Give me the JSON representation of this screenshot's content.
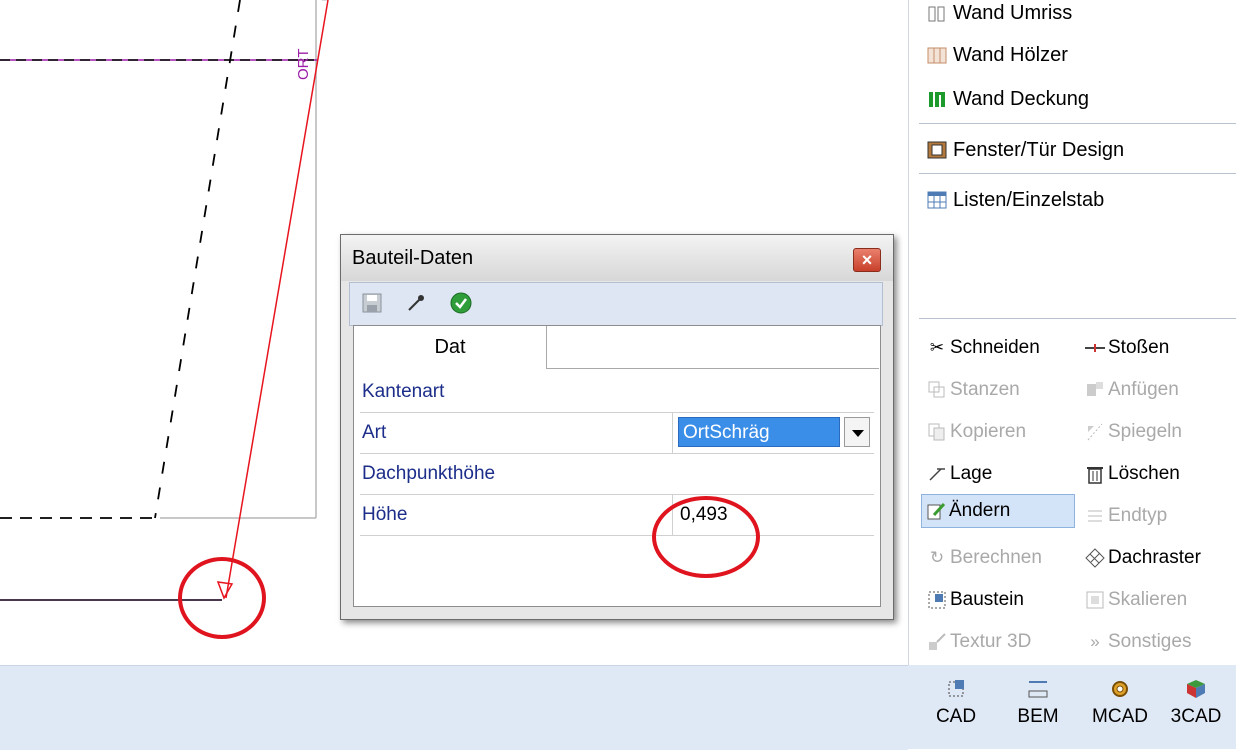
{
  "right_panel": {
    "menu": [
      {
        "label": "Wand Umriss",
        "icon": "wall-outline-icon"
      },
      {
        "label": "Wand Hölzer",
        "icon": "wall-timber-icon"
      },
      {
        "label": "Wand Deckung",
        "icon": "wall-covering-icon"
      },
      {
        "label": "Fenster/Tür Design",
        "icon": "window-door-icon"
      },
      {
        "label": "Listen/Einzelstab",
        "icon": "list-table-icon"
      }
    ],
    "tools": [
      {
        "label": "Schneiden",
        "icon": "scissors-icon",
        "enabled": true
      },
      {
        "label": "Stoßen",
        "icon": "butt-join-icon",
        "enabled": true
      },
      {
        "label": "Stanzen",
        "icon": "punch-icon",
        "enabled": false
      },
      {
        "label": "Anfügen",
        "icon": "append-icon",
        "enabled": false
      },
      {
        "label": "Kopieren",
        "icon": "copy-icon",
        "enabled": false
      },
      {
        "label": "Spiegeln",
        "icon": "mirror-icon",
        "enabled": false
      },
      {
        "label": "Lage",
        "icon": "position-icon",
        "enabled": true
      },
      {
        "label": "Löschen",
        "icon": "trash-icon",
        "enabled": true
      },
      {
        "label": "Ändern",
        "icon": "edit-icon",
        "enabled": true,
        "active": true
      },
      {
        "label": "Endtyp",
        "icon": "end-type-icon",
        "enabled": false
      },
      {
        "label": "Berechnen",
        "icon": "calculate-icon",
        "enabled": false
      },
      {
        "label": "Dachraster",
        "icon": "roof-grid-icon",
        "enabled": true
      },
      {
        "label": "Baustein",
        "icon": "building-block-icon",
        "enabled": true
      },
      {
        "label": "Skalieren",
        "icon": "scale-icon",
        "enabled": false
      },
      {
        "label": "Textur 3D",
        "icon": "texture-3d-icon",
        "enabled": false
      },
      {
        "label": "Sonstiges",
        "icon": "more-icon",
        "enabled": false
      }
    ],
    "tabs": [
      {
        "label": "CAD",
        "icon": "cad-icon"
      },
      {
        "label": "BEM",
        "icon": "dimension-icon"
      },
      {
        "label": "MCAD",
        "icon": "gear-icon"
      },
      {
        "label": "3CAD",
        "icon": "cube-3d-icon"
      }
    ]
  },
  "canvas": {
    "edge_label": "ORT",
    "colors": {
      "edge": "#e8141e",
      "purple": "#9b1fa8",
      "dashed": "#000000"
    }
  },
  "dialog": {
    "title": "Bauteil-Daten",
    "close_symbol": "×",
    "toolbar_icons": [
      "save-icon",
      "eyedropper-icon",
      "confirm-check-icon"
    ],
    "tab": "Dat",
    "section1": "Kantenart",
    "art_label": "Art",
    "art_value": "OrtSchräg",
    "section2": "Dachpunkthöhe",
    "hoehe_label": "Höhe",
    "hoehe_value": "0,493"
  },
  "colors": {
    "annotation": "#e0141e",
    "selection": "#3b8ee8",
    "label_blue": "#1c2e8a"
  }
}
